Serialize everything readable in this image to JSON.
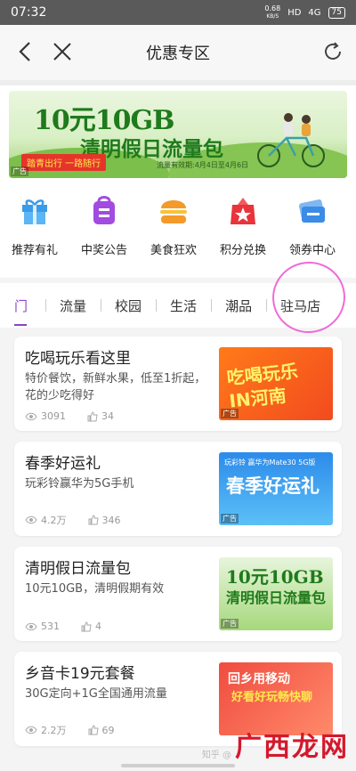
{
  "status_bar": {
    "time": "07:32",
    "speed": "0.68",
    "speed_unit": "KB/S",
    "hd": "HD",
    "signal": "4G",
    "battery": "75"
  },
  "header": {
    "title": "优惠专区"
  },
  "banner": {
    "title": "10元10GB",
    "subtitle": "清明假日流量包",
    "ribbon": "踏青出行 一路随行",
    "validity": "流量有效期:4月4日至4月6日",
    "ad_tag": "广告"
  },
  "quick_icons": [
    {
      "label": "推荐有礼",
      "icon": "gift-icon",
      "color": "#3a9be8"
    },
    {
      "label": "中奖公告",
      "icon": "notice-bag-icon",
      "color": "#a24be0"
    },
    {
      "label": "美食狂欢",
      "icon": "burger-icon",
      "color": "#f39a2b"
    },
    {
      "label": "积分兑换",
      "icon": "star-bag-icon",
      "color": "#e8343a"
    },
    {
      "label": "领券中心",
      "icon": "coupon-icon",
      "color": "#3b8ce6"
    }
  ],
  "tabs": [
    {
      "label": "门"
    },
    {
      "label": "流量"
    },
    {
      "label": "校园"
    },
    {
      "label": "生活"
    },
    {
      "label": "潮品"
    },
    {
      "label": "驻马店"
    }
  ],
  "cards": [
    {
      "title": "吃喝玩乐看这里",
      "desc": "特价餐饮，新鲜水果，低至1折起，花的少吃得好",
      "views": "3091",
      "likes": "34",
      "thumb_text": "吃喝玩乐 IN河南",
      "ad_tag": "广告"
    },
    {
      "title": "春季好运礼",
      "desc": "玩彩铃赢华为5G手机",
      "views": "4.2万",
      "likes": "346",
      "thumb_text": "春季好运礼",
      "thumb_sub": "玩彩铃 赢华为Mate30 5G版",
      "ad_tag": "广告"
    },
    {
      "title": "清明假日流量包",
      "desc": "10元10GB，清明假期有效",
      "views": "531",
      "likes": "4",
      "thumb_text": "10元10GB",
      "thumb_sub": "清明假日流量包",
      "ad_tag": "广告"
    },
    {
      "title": "乡音卡19元套餐",
      "desc": "30G定向+1G全国通用流量",
      "views": "2.2万",
      "likes": "69",
      "thumb_text": "回乡用移动",
      "thumb_sub": "好看好玩畅快聊",
      "ad_tag": "广告"
    }
  ],
  "watermark": {
    "big": "广西龙网",
    "small": "知乎 @"
  }
}
